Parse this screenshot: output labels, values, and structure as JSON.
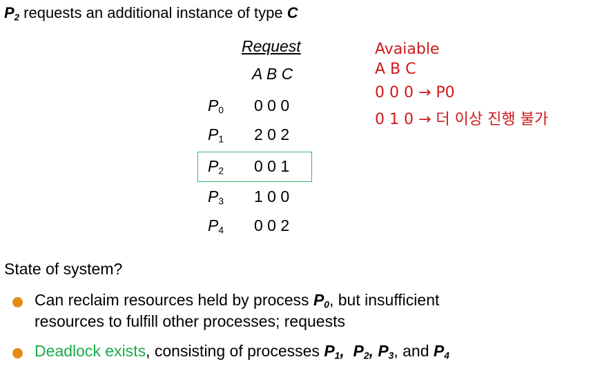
{
  "title": {
    "p": "P",
    "sub": "2",
    "text": " requests an additional instance of type ",
    "type": "C"
  },
  "table": {
    "header": "Request",
    "columns": "A B C",
    "rows": [
      {
        "p": "P",
        "sub": "0",
        "values": "0 0 0"
      },
      {
        "p": "P",
        "sub": "1",
        "values": "2 0 2"
      },
      {
        "p": "P",
        "sub": "2",
        "values": "0 0 1"
      },
      {
        "p": "P",
        "sub": "3",
        "values": "1 0 0"
      },
      {
        "p": "P",
        "sub": "4",
        "values": "0 0 2"
      }
    ]
  },
  "annotation": {
    "line1": "Avaiable",
    "line2": "A B C",
    "line3": "0 0 0 → P0",
    "line4": "0 1 0 → 더 이상 진행 불가",
    "color": "#d01818"
  },
  "state": "State of system?",
  "bullets": {
    "b1": {
      "pre": "Can reclaim resources held by process ",
      "p": "P",
      "sub": "0",
      "post": ", but insufficient",
      "line2": "resources to fulfill other processes; requests"
    },
    "b2": {
      "green": "Deadlock exists",
      "pre": ", consisting of processes ",
      "p1": "P",
      "s1": "1",
      "sep1": ",  ",
      "p2": "P",
      "s2": "2",
      "sep2": ", ",
      "p3": "P",
      "s3": "3",
      "sep3": ", and ",
      "p4": "P",
      "s4": "4"
    }
  },
  "colors": {
    "bullet": "#e58b14",
    "highlight_box": "#3cb56a",
    "green_text": "#1aab48"
  }
}
